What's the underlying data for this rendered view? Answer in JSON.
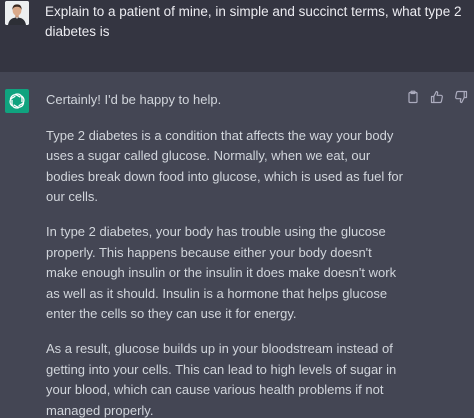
{
  "user_message": {
    "text": "Explain to a patient of mine, in simple and succinct terms, what type 2 diabetes is"
  },
  "assistant_message": {
    "greeting": "Certainly! I'd be happy to help.",
    "paragraphs": [
      "Type 2 diabetes is a condition that affects the way your body uses a sugar called glucose. Normally, when we eat, our bodies break down food into glucose, which is used as fuel for our cells.",
      "In type 2 diabetes, your body has trouble using the glucose properly. This happens because either your body doesn't make enough insulin or the insulin it does make doesn't work as well as it should. Insulin is a hormone that helps glucose enter the cells so they can use it for energy.",
      "As a result, glucose builds up in your bloodstream instead of getting into your cells. This can lead to high levels of sugar in your blood, which can cause various health problems if not managed properly."
    ]
  },
  "icons": {
    "user_avatar": "user-avatar",
    "assistant_avatar": "openai-logo-icon",
    "copy": "clipboard-icon",
    "like": "thumbs-up-icon",
    "dislike": "thumbs-down-icon"
  },
  "colors": {
    "user_bg": "#343541",
    "assistant_bg": "#444654",
    "brand": "#10a37f",
    "text": "#d1d5db"
  }
}
